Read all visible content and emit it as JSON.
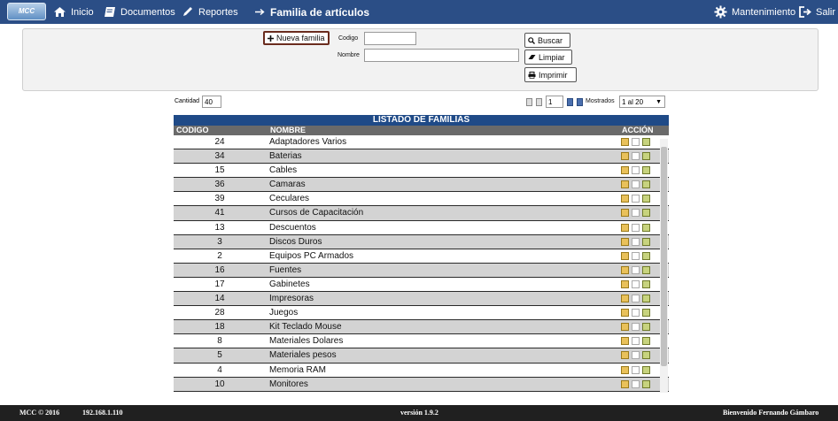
{
  "app": {
    "logo_text": "MCC",
    "nav": {
      "home": "Inicio",
      "documents": "Documentos",
      "reports": "Reportes",
      "current_page": "Familia de artículos",
      "maintenance": "Mantenimiento",
      "logout": "Salir"
    }
  },
  "form": {
    "new_family_button": "Nueva familia",
    "code_label": "Codigo",
    "code_value": "",
    "name_label": "Nombre",
    "name_value": "",
    "search_button": "Buscar",
    "clear_button": "Limpiar",
    "print_button": "Imprimir"
  },
  "toolbar": {
    "quantity_label": "Cantidad",
    "quantity_value": "40",
    "page_value": "1",
    "shown_label": "Mostrados",
    "shown_selected": "1 al 20"
  },
  "table": {
    "title": "LISTADO DE FAMILIAS",
    "headers": {
      "code": "CODIGO",
      "name": "NOMBRE",
      "action": "ACCIÓN"
    },
    "rows": [
      {
        "code": "24",
        "name": "Adaptadores Varios"
      },
      {
        "code": "34",
        "name": "Baterias"
      },
      {
        "code": "15",
        "name": "Cables"
      },
      {
        "code": "36",
        "name": "Camaras"
      },
      {
        "code": "39",
        "name": "Ceculares"
      },
      {
        "code": "41",
        "name": "Cursos de Capacitación"
      },
      {
        "code": "13",
        "name": "Descuentos"
      },
      {
        "code": "3",
        "name": "Discos Duros"
      },
      {
        "code": "2",
        "name": "Equipos PC Armados"
      },
      {
        "code": "16",
        "name": "Fuentes"
      },
      {
        "code": "17",
        "name": "Gabinetes"
      },
      {
        "code": "14",
        "name": "Impresoras"
      },
      {
        "code": "28",
        "name": "Juegos"
      },
      {
        "code": "18",
        "name": "Kit Teclado Mouse"
      },
      {
        "code": "8",
        "name": "Materiales Dolares"
      },
      {
        "code": "5",
        "name": "Materiales pesos"
      },
      {
        "code": "4",
        "name": "Memoria RAM"
      },
      {
        "code": "10",
        "name": "Monitores"
      }
    ]
  },
  "footer": {
    "left": "MCC © 2016",
    "left_ip": "192.168.1.110",
    "version": "versión 1.9.2",
    "welcome": "Bienvenido Fernando Gámbaro"
  },
  "colors": {
    "topbar": "#2b4e86",
    "table_title": "#1f4a87",
    "table_header": "#6a6a6a",
    "footer": "#202020"
  }
}
